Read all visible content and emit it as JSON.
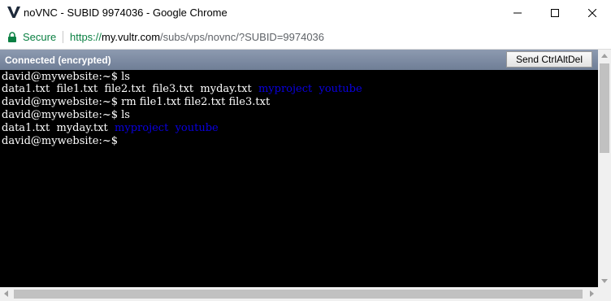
{
  "window": {
    "title": "noVNC - SUBID 9974036 - Google Chrome",
    "logo_icon": "v-logo-icon",
    "controls": [
      "minimize-icon",
      "maximize-icon",
      "close-icon"
    ]
  },
  "address_bar": {
    "secure_label": "Secure",
    "url_scheme": "https://",
    "url_host": "my.vultr.com",
    "url_path": "/subs/vps/novnc/?SUBID=9974036",
    "secure_color": "#0b8043"
  },
  "novnc": {
    "status": "Connected (encrypted)",
    "ctrlaltdel_label": "Send CtrlAltDel",
    "bar_color": "#7f8ca3"
  },
  "terminal": {
    "background": "#000000",
    "text_color": "#ffffff",
    "dir_color": "#0a00e0",
    "lines": [
      {
        "files": "david@mywebsite:~$ ls",
        "dirs": ""
      },
      {
        "files": "data1.txt  file1.txt  file2.txt  file3.txt  myday.txt  ",
        "dirs": "myproject  youtube"
      },
      {
        "files": "david@mywebsite:~$ rm file1.txt file2.txt file3.txt",
        "dirs": ""
      },
      {
        "files": "david@mywebsite:~$ ls",
        "dirs": ""
      },
      {
        "files": "data1.txt  myday.txt  ",
        "dirs": "myproject  youtube"
      },
      {
        "files": "david@mywebsite:~$",
        "dirs": ""
      }
    ]
  }
}
